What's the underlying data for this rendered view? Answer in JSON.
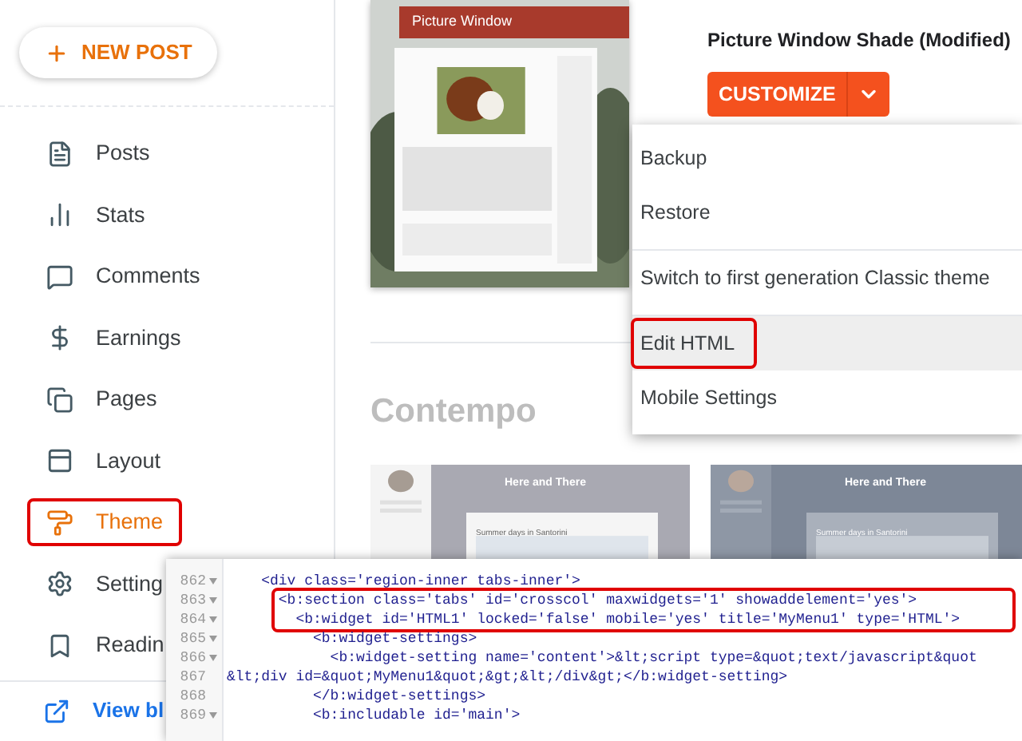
{
  "new_post_button": {
    "label": "NEW POST"
  },
  "sidebar": {
    "items": [
      {
        "label": "Posts",
        "selected": false,
        "highlighted": false
      },
      {
        "label": "Stats",
        "selected": false,
        "highlighted": false
      },
      {
        "label": "Comments",
        "selected": false,
        "highlighted": false
      },
      {
        "label": "Earnings",
        "selected": false,
        "highlighted": false
      },
      {
        "label": "Pages",
        "selected": false,
        "highlighted": false
      },
      {
        "label": "Layout",
        "selected": false,
        "highlighted": false
      },
      {
        "label": "Theme",
        "selected": true,
        "highlighted": true
      },
      {
        "label": "Setting",
        "selected": false,
        "highlighted": false
      },
      {
        "label": "Readin",
        "selected": false,
        "highlighted": false
      }
    ],
    "view_blog": "View bl"
  },
  "current_theme": {
    "preview_title": "Picture Window",
    "name": "Picture Window Shade (Modified)",
    "customize_button": "CUSTOMIZE"
  },
  "dropdown_menu": {
    "items": [
      {
        "label": "Backup",
        "highlighted": false,
        "divider_after": false
      },
      {
        "label": "Restore",
        "highlighted": false,
        "divider_after": true
      },
      {
        "label": "Switch to first generation Classic theme",
        "highlighted": false,
        "divider_after": true
      },
      {
        "label": "Edit HTML",
        "highlighted": true,
        "divider_after": false
      },
      {
        "label": "Mobile Settings",
        "highlighted": false,
        "divider_after": false
      }
    ]
  },
  "theme_gallery": {
    "heading": "Contempo",
    "themes": [
      {
        "title": "Here and There",
        "post": "Summer days in Santorini",
        "dark": false
      },
      {
        "title": "Here and There",
        "post": "Summer days in Santorini",
        "dark": true
      }
    ]
  },
  "code_editor": {
    "lines": [
      {
        "number": "862",
        "foldable": true,
        "highlighted": false,
        "text": "    <div class='region-inner tabs-inner'>"
      },
      {
        "number": "863",
        "foldable": true,
        "highlighted": true,
        "text": "      <b:section class='tabs' id='crosscol' maxwidgets='1' showaddelement='yes'>"
      },
      {
        "number": "864",
        "foldable": true,
        "highlighted": true,
        "text": "        <b:widget id='HTML1' locked='false' mobile='yes' title='MyMenu1' type='HTML'>"
      },
      {
        "number": "865",
        "foldable": true,
        "highlighted": false,
        "text": "          <b:widget-settings>"
      },
      {
        "number": "866",
        "foldable": true,
        "highlighted": false,
        "text": "            <b:widget-setting name='content'>&lt;script type=&quot;text/javascript&quot"
      },
      {
        "number": "867",
        "foldable": false,
        "highlighted": false,
        "text": "&lt;div id=&quot;MyMenu1&quot;&gt;&lt;/div&gt;</b:widget-setting>"
      },
      {
        "number": "868",
        "foldable": false,
        "highlighted": false,
        "text": "          </b:widget-settings>"
      },
      {
        "number": "869",
        "foldable": true,
        "highlighted": false,
        "text": "          <b:includable id='main'>"
      }
    ]
  }
}
